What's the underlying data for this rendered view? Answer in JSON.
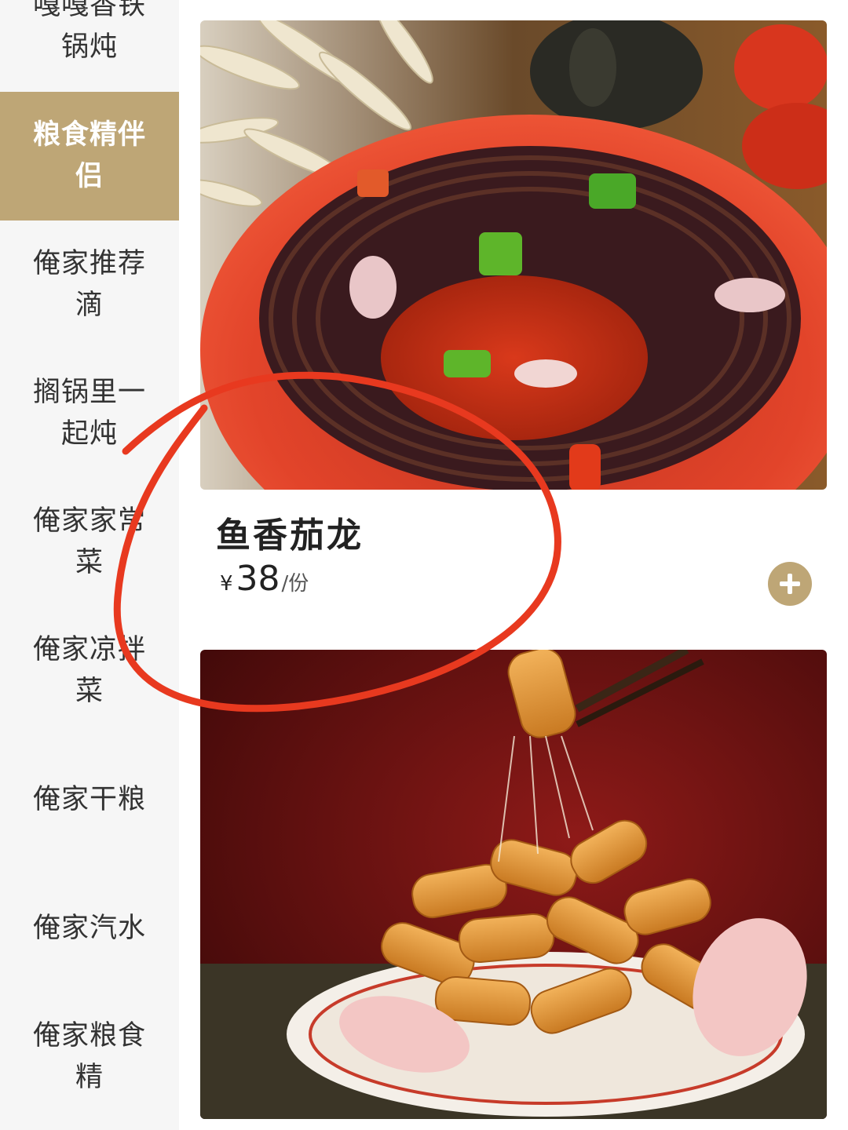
{
  "sidebar": {
    "items": [
      {
        "label": "嘎嘎香铁锅炖",
        "active": false
      },
      {
        "label": "粮食精伴侣",
        "active": true
      },
      {
        "label": "俺家推荐滴",
        "active": false
      },
      {
        "label": "搁锅里一起炖",
        "active": false
      },
      {
        "label": "俺家家常菜",
        "active": false
      },
      {
        "label": "俺家凉拌菜",
        "active": false
      },
      {
        "label": "俺家干粮",
        "active": false
      },
      {
        "label": "俺家汽水",
        "active": false
      },
      {
        "label": "俺家粮食精",
        "active": false
      }
    ]
  },
  "dishes": [
    {
      "name": "鱼香茄龙",
      "currency": "¥",
      "price": "38",
      "unit": "/份",
      "image_icon": "stuffed-eggplant-photo"
    },
    {
      "name": "",
      "image_icon": "sweet-sour-pork-photo"
    }
  ],
  "colors": {
    "accent": "#bea676",
    "annotation": "#e8391f",
    "sidebar_bg": "#f6f6f6"
  }
}
